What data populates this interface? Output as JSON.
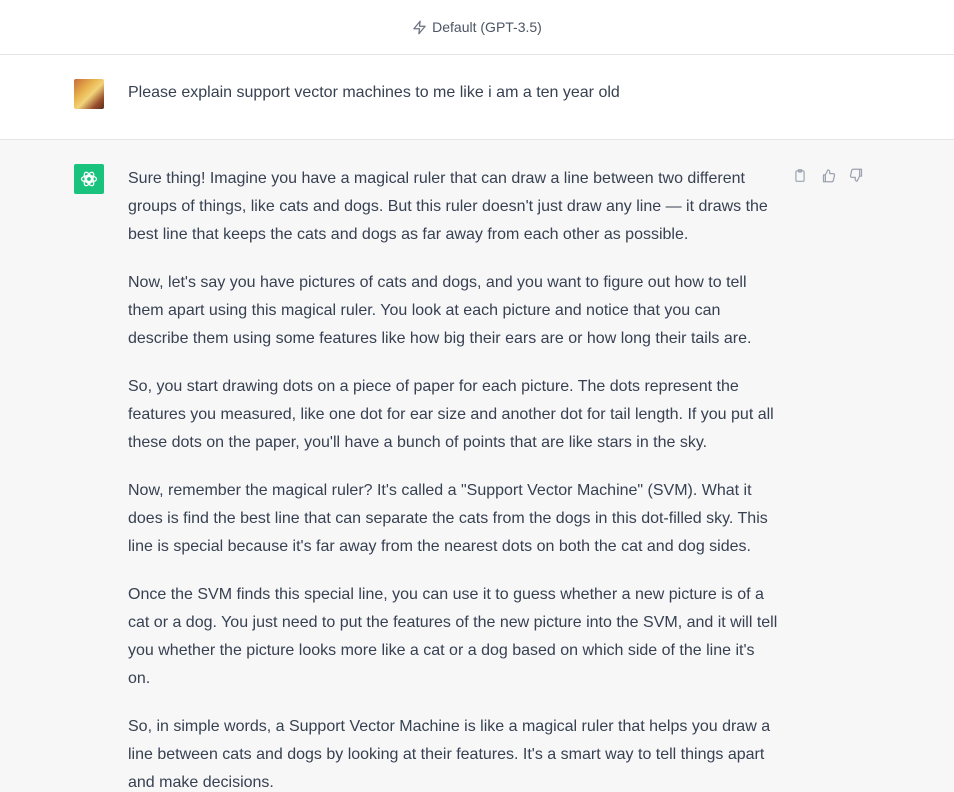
{
  "header": {
    "model_label": "Default (GPT-3.5)",
    "model_icon": "bolt-icon"
  },
  "user_message": {
    "avatar": "user-avatar",
    "text": "Please explain support vector machines to me like i am a ten year old"
  },
  "assistant_message": {
    "avatar": "chatgpt-logo-icon",
    "paragraphs": [
      "Sure thing! Imagine you have a magical ruler that can draw a line between two different groups of things, like cats and dogs. But this ruler doesn't just draw any line — it draws the best line that keeps the cats and dogs as far away from each other as possible.",
      "Now, let's say you have pictures of cats and dogs, and you want to figure out how to tell them apart using this magical ruler. You look at each picture and notice that you can describe them using some features like how big their ears are or how long their tails are.",
      "So, you start drawing dots on a piece of paper for each picture. The dots represent the features you measured, like one dot for ear size and another dot for tail length. If you put all these dots on the paper, you'll have a bunch of points that are like stars in the sky.",
      "Now, remember the magical ruler? It's called a \"Support Vector Machine\" (SVM). What it does is find the best line that can separate the cats from the dogs in this dot-filled sky. This line is special because it's far away from the nearest dots on both the cat and dog sides.",
      "Once the SVM finds this special line, you can use it to guess whether a new picture is of a cat or a dog. You just need to put the features of the new picture into the SVM, and it will tell you whether the picture looks more like a cat or a dog based on which side of the line it's on.",
      "So, in simple words, a Support Vector Machine is like a magical ruler that helps you draw a line between cats and dogs by looking at their features. It's a smart way to tell things apart and make decisions."
    ],
    "actions": [
      "copy-icon",
      "thumbs-up-icon",
      "thumbs-down-icon"
    ]
  },
  "colors": {
    "accent": "#19c37d",
    "assistant_bg": "#f7f7f8",
    "text": "#374151"
  }
}
